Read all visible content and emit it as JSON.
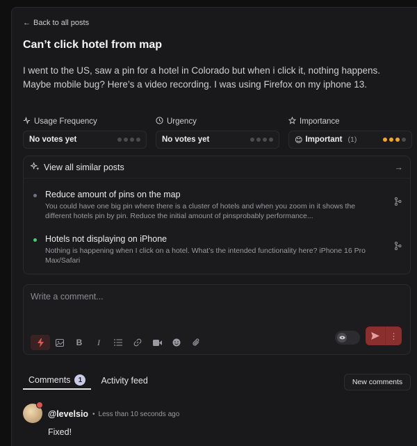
{
  "back": {
    "label": "Back to all posts"
  },
  "post": {
    "title": "Can’t click hotel from map",
    "description": "I went to the US, saw a pin for a hotel in Colorado but when i click it, nothing happens. Maybe mobile bug? Here’s a video recording. I was using Firefox on my iphone 13."
  },
  "votes": [
    {
      "label": "Usage Frequency",
      "icon": "activity-icon",
      "value": "No votes yet",
      "level": 0
    },
    {
      "label": "Urgency",
      "icon": "clock-icon",
      "value": "No votes yet",
      "level": 0
    },
    {
      "label": "Importance",
      "icon": "star-icon",
      "value": "Important",
      "emoji": "😊",
      "count": "(1)",
      "level": 3
    }
  ],
  "similar": {
    "header": "View all similar posts",
    "items": [
      {
        "title": "Reduce amount of pins on the map",
        "desc": "You could have one big pin where there is a cluster of hotels and when you zoom in it shows the different hotels pin by pin. Reduce the initial amount of pinsprobably performance...",
        "status_color": "#6b7385"
      },
      {
        "title": "Hotels not displaying on iPhone",
        "desc": "Nothing is happening when I click on a hotel. What’s the intended functionality here? iPhone 16 Pro Max/Safari",
        "status_color": "#3fce7a"
      }
    ]
  },
  "comment_box": {
    "placeholder": "Write a comment..."
  },
  "tabs": [
    {
      "label": "Comments",
      "count": "1"
    },
    {
      "label": "Activity feed"
    }
  ],
  "new_comments_label": "New comments",
  "comment": {
    "user": "@levelsio",
    "time": "Less than 10 seconds ago",
    "text": "Fixed!"
  },
  "colors": {
    "accent_red": "#8b2e2e",
    "importance_dot": "#f5a623",
    "background": "#19191b"
  }
}
